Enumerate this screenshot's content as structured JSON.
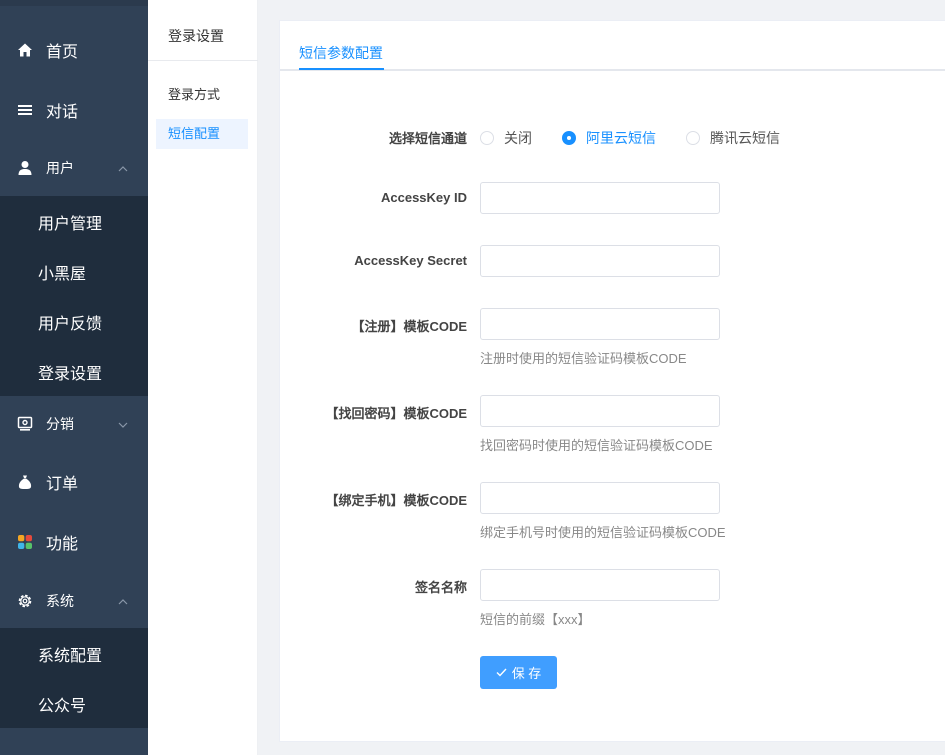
{
  "sidebar": {
    "items": [
      {
        "label": "首页",
        "icon": "home-icon"
      },
      {
        "label": "对话",
        "icon": "menu-lines-icon"
      },
      {
        "label": "用户",
        "icon": "user-icon"
      },
      {
        "label": "分销",
        "icon": "distribution-icon"
      },
      {
        "label": "订单",
        "icon": "money-bag-icon"
      },
      {
        "label": "功能",
        "icon": "grid-color-icon"
      },
      {
        "label": "系统",
        "icon": "gear-icon"
      }
    ],
    "user_submenu": [
      "用户管理",
      "小黑屋",
      "用户反馈",
      "登录设置"
    ],
    "system_submenu": [
      "系统配置",
      "公众号"
    ]
  },
  "subnav": {
    "title": "登录设置",
    "items": [
      "登录方式",
      "短信配置"
    ],
    "active": "短信配置"
  },
  "tab": {
    "label": "短信参数配置"
  },
  "form": {
    "channel": {
      "label": "选择短信通道",
      "options": [
        "关闭",
        "阿里云短信",
        "腾讯云短信"
      ],
      "selected": "阿里云短信"
    },
    "access_key_id": {
      "label": "AccessKey ID",
      "value": ""
    },
    "access_key_secret": {
      "label": "AccessKey Secret",
      "value": ""
    },
    "register_code": {
      "label": "【注册】模板CODE",
      "value": "",
      "hint": "注册时使用的短信验证码模板CODE"
    },
    "recover_code": {
      "label": "【找回密码】模板CODE",
      "value": "",
      "hint": "找回密码时使用的短信验证码模板CODE"
    },
    "bind_code": {
      "label": "【绑定手机】模板CODE",
      "value": "",
      "hint": "绑定手机号时使用的短信验证码模板CODE"
    },
    "signature": {
      "label": "签名名称",
      "value": "",
      "hint": "短信的前缀【xxx】"
    },
    "save_label": "保 存"
  },
  "colors": {
    "accent": "#1890ff",
    "sidebar_bg": "#304156",
    "submenu_bg": "#1f2d3d"
  }
}
